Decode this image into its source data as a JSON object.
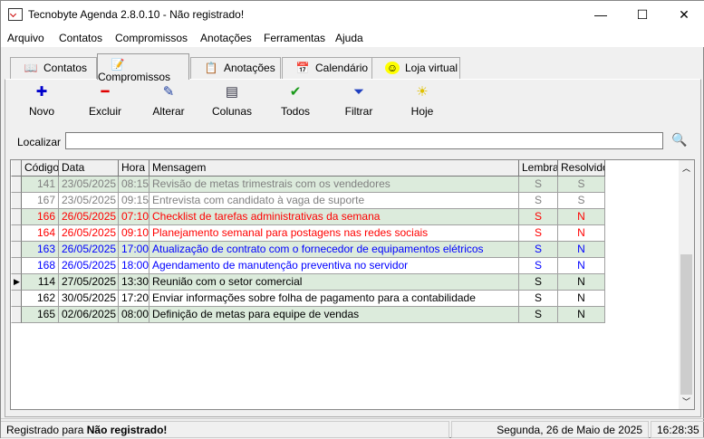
{
  "window": {
    "title": "Tecnobyte Agenda 2.8.0.10 - Não registrado!",
    "minimize": "—",
    "maximize": "☐",
    "close": "✕"
  },
  "menu": [
    "Arquivo",
    "Contatos",
    "Compromissos",
    "Anotações",
    "Ferramentas",
    "Ajuda"
  ],
  "tabs": [
    {
      "label": "Contatos",
      "icon": "📖"
    },
    {
      "label": "Compromissos",
      "icon": "📝"
    },
    {
      "label": "Anotações",
      "icon": "📋"
    },
    {
      "label": "Calendário",
      "icon": "📅"
    },
    {
      "label": "Loja virtual",
      "icon": "☺"
    }
  ],
  "active_tab": "Compromissos",
  "toolbar": [
    {
      "label": "Novo",
      "icon": "✚",
      "color": "#0000cc"
    },
    {
      "label": "Excluir",
      "icon": "━",
      "color": "#e00000"
    },
    {
      "label": "Alterar",
      "icon": "✎",
      "color": "#2040a0"
    },
    {
      "label": "Colunas",
      "icon": "▤",
      "color": "#334"
    },
    {
      "label": "Todos",
      "icon": "✔",
      "color": "#1a9a1a"
    },
    {
      "label": "Filtrar",
      "icon": "⏷",
      "color": "#2040c0"
    },
    {
      "label": "Hoje",
      "icon": "☀",
      "color": "#e0c000"
    }
  ],
  "search": {
    "label": "Localizar",
    "value": "",
    "icon": "🔍"
  },
  "grid": {
    "columns": [
      "Código",
      "Data",
      "Hora",
      "Mensagem",
      "Lembrar",
      "Resolvido"
    ],
    "colors": {
      "gray": "#808080",
      "red": "#ff0000",
      "blue": "#0000ff",
      "black": "#000000",
      "row_alt": "#dcebdc"
    },
    "rows": [
      [
        "141",
        "23/05/2025",
        "08:15",
        "Revisão de metas trimestrais com os vendedores",
        "S",
        "S",
        "gray"
      ],
      [
        "167",
        "23/05/2025",
        "09:15",
        "Entrevista com candidato à vaga de suporte",
        "S",
        "S",
        "gray"
      ],
      [
        "166",
        "26/05/2025",
        "07:10",
        "Checklist de tarefas administrativas da semana",
        "S",
        "N",
        "red"
      ],
      [
        "164",
        "26/05/2025",
        "09:10",
        "Planejamento semanal  para postagens nas redes sociais",
        "S",
        "N",
        "red"
      ],
      [
        "163",
        "26/05/2025",
        "17:00",
        "Atualização de contrato com o fornecedor de equipamentos elétricos",
        "S",
        "N",
        "blue"
      ],
      [
        "168",
        "26/05/2025",
        "18:00",
        "Agendamento de manutenção preventiva no servidor",
        "S",
        "N",
        "blue"
      ],
      [
        "114",
        "27/05/2025",
        "13:30",
        "Reunião com o setor comercial",
        "S",
        "N",
        "black"
      ],
      [
        "162",
        "30/05/2025",
        "17:20",
        "Enviar informações sobre folha de pagamento para a contabilidade",
        "S",
        "N",
        "black"
      ],
      [
        "165",
        "02/06/2025",
        "08:00",
        "Definição de metas para equipe de vendas",
        "S",
        "N",
        "black"
      ]
    ],
    "current_row": 6
  },
  "status": {
    "registered_label": "Registrado para",
    "registered_value": "Não registrado!",
    "date": "Segunda, 26 de Maio de 2025",
    "time": "16:28:35"
  }
}
